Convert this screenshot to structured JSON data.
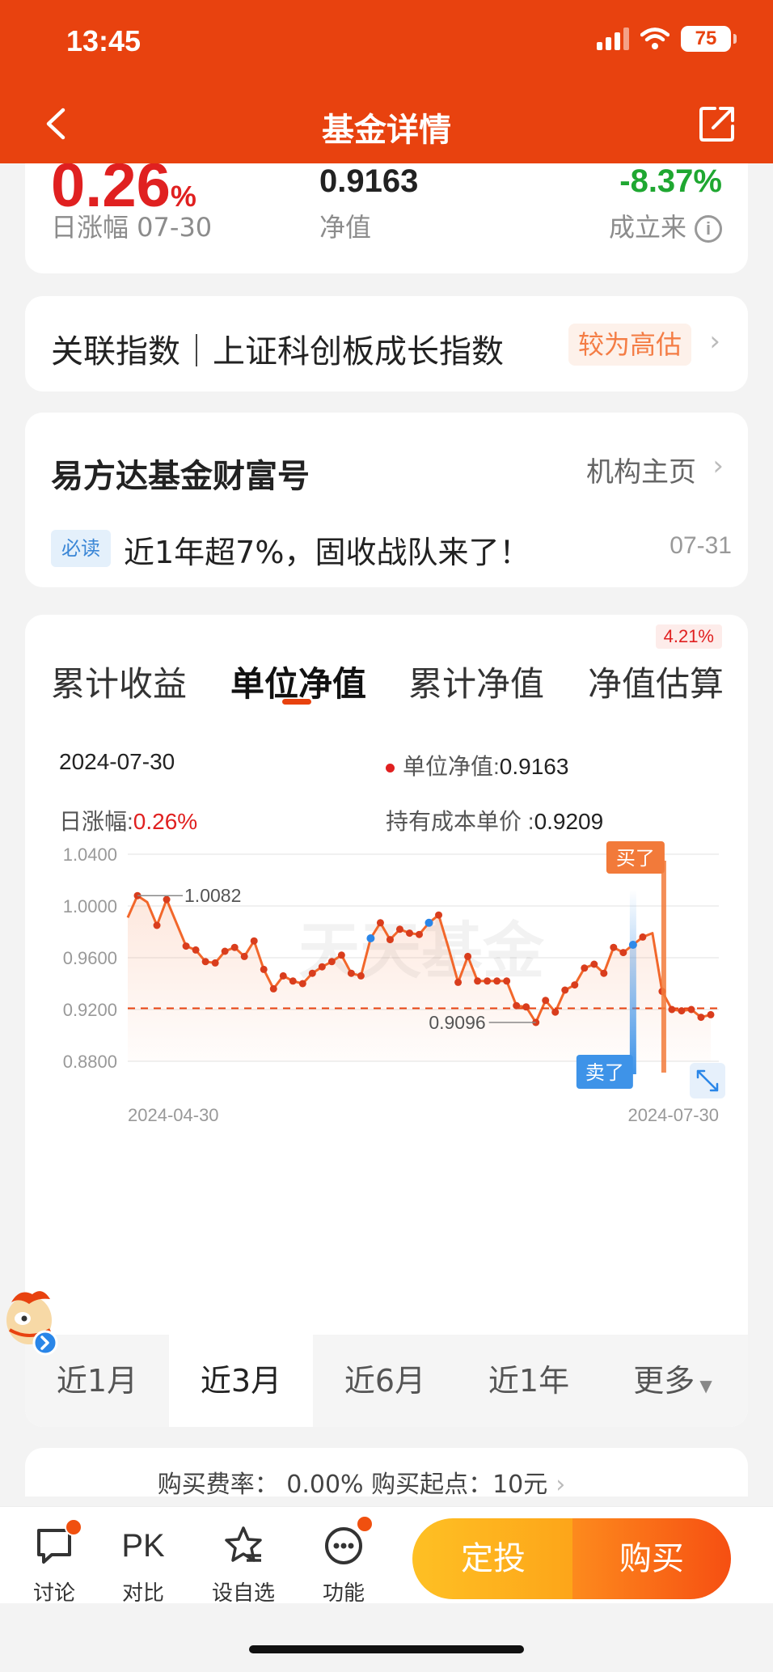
{
  "status_bar": {
    "time": "13:45",
    "battery": "75"
  },
  "nav": {
    "title": "基金详情"
  },
  "summary": {
    "daily_rate_partial": "0.26",
    "daily_rate_unit": "%",
    "daily_label": "日涨幅 07-30",
    "nav_value": "0.9163",
    "nav_label": "净值",
    "since_rate": "-8.37%",
    "since_label": "成立来"
  },
  "index_card": {
    "text": "关联指数｜上证科创板成长指数",
    "valuation": "较为高估"
  },
  "wealth_card": {
    "title": "易方达基金财富号",
    "org_link": "机构主页",
    "tag": "必读",
    "news": "近1年超7%，固收战队来了！",
    "news_date": "07-31"
  },
  "chart_card": {
    "tabs": [
      "累计收益",
      "单位净值",
      "累计净值",
      "净值估算"
    ],
    "active_tab": 1,
    "estimate_badge": "4.21%",
    "info": {
      "date": "2024-07-30",
      "nav_label": "单位净值:",
      "nav_value": "0.9163",
      "daily_label": "日涨幅:",
      "daily_value": "0.26%",
      "cost_label": "持有成本单价 :",
      "cost_value": "0.9209"
    },
    "periods": [
      "近1月",
      "近3月",
      "近6月",
      "近1年",
      "更多"
    ],
    "active_period": 1
  },
  "chart_data": {
    "type": "line",
    "ylim": [
      0.88,
      1.04
    ],
    "yticks": [
      "1.0400",
      "1.0000",
      "0.9600",
      "0.9200",
      "0.8800"
    ],
    "x_start": "2024-04-30",
    "x_end": "2024-07-30",
    "series": [
      {
        "values": [
          0.991,
          1.008,
          1.003,
          0.985,
          1.005,
          0.987,
          0.969,
          0.966,
          0.957,
          0.956,
          0.965,
          0.968,
          0.961,
          0.973,
          0.951,
          0.936,
          0.946,
          0.942,
          0.94,
          0.948,
          0.953,
          0.957,
          0.962,
          0.948,
          0.946,
          0.975,
          0.987,
          0.974,
          0.982,
          0.979,
          0.978,
          0.987,
          0.993,
          0.968,
          0.941,
          0.961,
          0.942,
          0.942,
          0.942,
          0.942,
          0.923,
          0.922,
          0.91,
          0.927,
          0.918,
          0.935,
          0.939,
          0.952,
          0.955,
          0.948,
          0.968,
          0.964,
          0.97,
          0.976,
          0.979,
          0.934,
          0.92,
          0.919,
          0.92,
          0.914,
          0.916
        ]
      }
    ],
    "max_label": "1.0082",
    "min_label": "0.9096",
    "cost_line": 0.9209,
    "buy_label": "买了",
    "sell_label": "卖了",
    "watermark": "天天基金"
  },
  "fee_row": {
    "text": "购买费率：  0.00%  购买起点：10元"
  },
  "bottom_bar": {
    "tools": [
      "讨论",
      "对比",
      "设自选",
      "功能"
    ],
    "pk_text": "PK",
    "fixed_label": "定投",
    "buy_label": "购买"
  }
}
